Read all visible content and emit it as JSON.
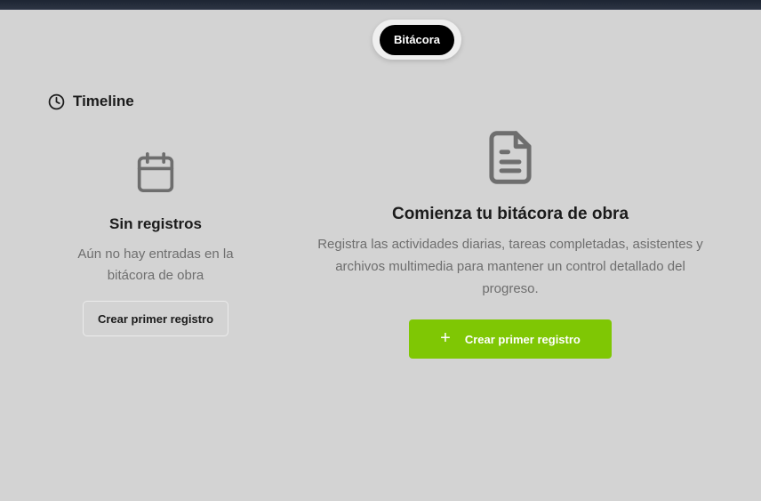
{
  "tabs": {
    "active_label": "Bitácora"
  },
  "timeline": {
    "title": "Timeline",
    "icon": "clock-icon",
    "empty_title": "Sin registros",
    "empty_description": "Aún no hay entradas en la bitácora de obra",
    "empty_icon": "calendar-icon",
    "create_button": "Crear primer registro"
  },
  "main_empty": {
    "icon": "document-icon",
    "title": "Comienza tu bitácora de obra",
    "description": "Registra las actividades diarias, tareas completadas, asistentes y archivos multimedia para mantener un control detallado del progreso.",
    "create_button": "Crear primer registro",
    "button_icon": "plus-icon"
  },
  "colors": {
    "background": "#d3d3d3",
    "primary": "#7fc704",
    "tab_active": "#000000",
    "muted_text": "#6e6e6e"
  }
}
